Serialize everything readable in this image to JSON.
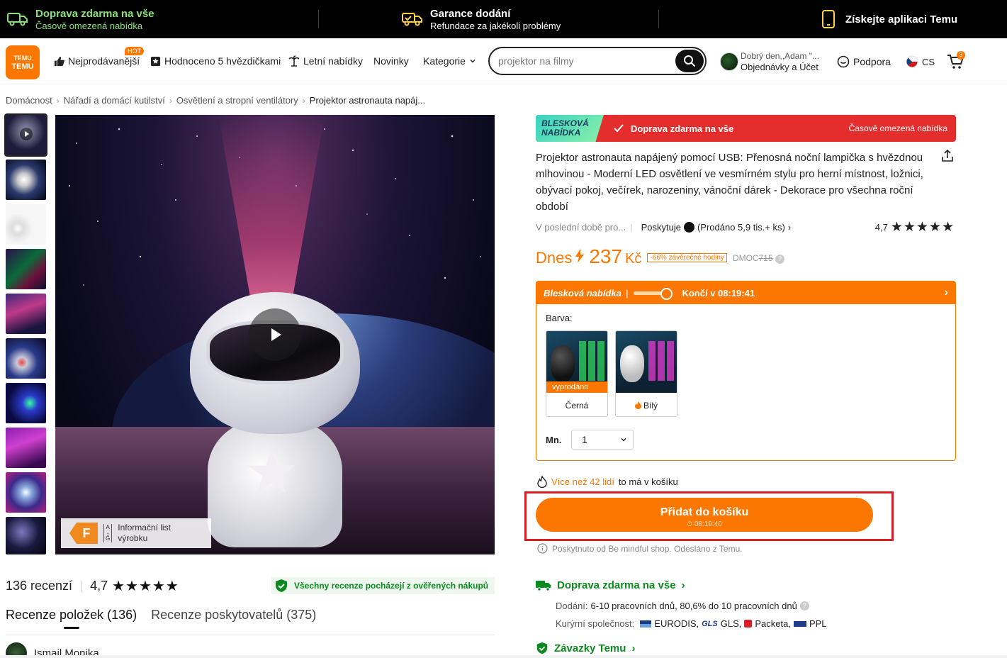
{
  "topbar": {
    "free_shipping_title": "Doprava zdarma na vše",
    "free_shipping_sub": "Časově omezená nabídka",
    "guarantee_title": "Garance dodání",
    "guarantee_sub": "Refundace za jakékoli problémy",
    "app_label": "Získejte aplikaci Temu"
  },
  "header": {
    "logo_text_top": "TEMU",
    "logo_text_bottom": "TEMU",
    "nav": {
      "bestsellers": "Nejprodávanější",
      "hot_badge": "HOT",
      "five_stars": "Hodnoceno 5 hvězdičkami",
      "summer": "Letní nabídky",
      "news": "Novinky",
      "categories": "Kategorie"
    },
    "search": {
      "value": "projektor na filmy"
    },
    "account": {
      "greeting": "Dobrý den,,Adam \"...",
      "orders": "Objednávky a Účet"
    },
    "support": "Podpora",
    "language": "CS",
    "cart_count": "3"
  },
  "breadcrumb": [
    "Domácnost",
    "Nářadí a domácí kutilství",
    "Osvětlení a stropní ventilátory",
    "Projektor astronauta napáj..."
  ],
  "gallery": {
    "energy_class": "F",
    "energy_scale_top": "A",
    "energy_scale_bottom": "G",
    "energy_label_1": "Informační list",
    "energy_label_2": "výrobku"
  },
  "reviews": {
    "count_label": "136 recenzí",
    "rating": "4,7",
    "stars": "★★★★★",
    "verified": "Všechny recenze pocházejí z ověřených nákupů",
    "tab_items": "Recenze položek (136)",
    "tab_providers": "Recenze poskytovatelů (375)",
    "first_reviewer": "Ismail Monika"
  },
  "product": {
    "flash_badge_1": "BLESKOVÁ",
    "flash_badge_2": "NABÍDKA",
    "flash_free": "Doprava zdarma na vše",
    "flash_limited": "Časově omezená nabídka",
    "title": "Projektor astronauta napájený pomocí USB: Přenosná noční lampička s hvězdnou mlhovinou - Moderní LED osvětlení ve vesmírném stylu pro herní místnost, ložnici, obývací pokoj, večírek, narozeniny, vánoční dárek - Dekorace pro všechna roční období",
    "recent": "V poslední době pro...",
    "provider_prefix": "Poskytuje",
    "sold": "(Prodáno 5,9 tis.+ ks)",
    "rating": "4,7",
    "price_today": "Dnes",
    "price": "237",
    "currency": "Kč",
    "discount": "-66% závěrečné hodiny",
    "dmoc_label": "DMOC",
    "dmoc_price": "715",
    "flash_box_title": "Blesková nabídka",
    "flash_box_ends": "Končí v 08:19:41",
    "color_label": "Barva:",
    "colors": [
      {
        "name": "Černá",
        "status": "vyprodáno"
      },
      {
        "name": "Bílý",
        "status": ""
      }
    ],
    "qty_label": "Mn.",
    "qty_value": "1",
    "in_cart_highlight": "Více než 42 lidí",
    "in_cart_rest": "to má v košíku",
    "add_to_cart": "Přidat do košíku",
    "add_to_cart_sub": "⏱ 08:19:40",
    "sold_by": "Poskytnuto od Be mindful shop. Odesláno z Temu.",
    "shipping_title": "Doprava zdarma na vše",
    "delivery_label": "Dodání:",
    "delivery_value": "6-10 pracovních dnů, 80,6% do 10 pracovních dnů",
    "couriers_label": "Kurýrní společnost:",
    "couriers": [
      "EURODIS,",
      "GLS,",
      "Packeta,",
      "PPL"
    ],
    "commitments": "Závazky Temu"
  },
  "colors": {
    "accent": "#fb7701",
    "green": "#0a8a1f",
    "red_banner": "#e42d2d",
    "highlight": "#d61f26"
  }
}
